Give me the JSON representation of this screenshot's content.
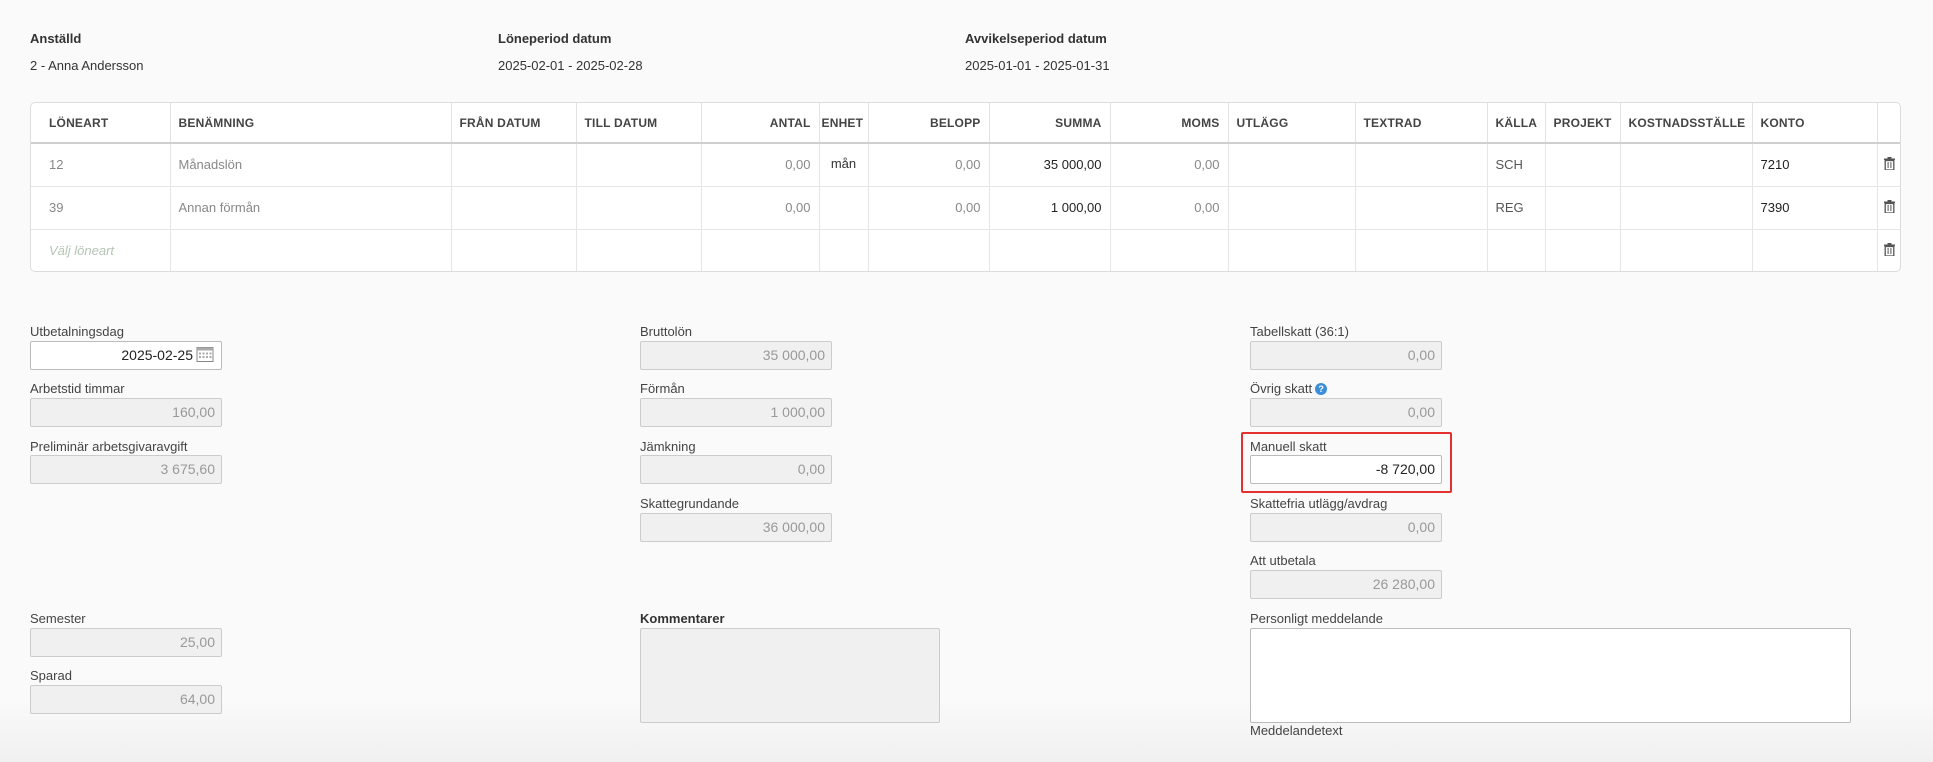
{
  "header": {
    "employee_label": "Anställd",
    "employee_value": "2 - Anna Andersson",
    "period_label": "Löneperiod datum",
    "period_value": "2025-02-01 - 2025-02-28",
    "deviation_label": "Avvikelseperiod datum",
    "deviation_value": "2025-01-01 - 2025-01-31"
  },
  "table": {
    "columns": [
      "LÖNEART",
      "BENÄMNING",
      "FRÅN DATUM",
      "TILL DATUM",
      "ANTAL",
      "ENHET",
      "BELOPP",
      "SUMMA",
      "MOMS",
      "UTLÄGG",
      "TEXTRAD",
      "KÄLLA",
      "PROJEKT",
      "KOSTNADSSTÄLLE",
      "KONTO"
    ],
    "rows": [
      {
        "loneart": "12",
        "benamning": "Månadslön",
        "fran": "",
        "till": "",
        "antal": "0,00",
        "enhet": "mån",
        "belopp": "0,00",
        "summa": "35 000,00",
        "moms": "0,00",
        "utlagg": "",
        "textrad": "",
        "kalla": "SCH",
        "projekt": "",
        "kostnadsstalle": "",
        "konto": "7210"
      },
      {
        "loneart": "39",
        "benamning": "Annan förmån",
        "fran": "",
        "till": "",
        "antal": "0,00",
        "enhet": "",
        "belopp": "0,00",
        "summa": "1 000,00",
        "moms": "0,00",
        "utlagg": "",
        "textrad": "",
        "kalla": "REG",
        "projekt": "",
        "kostnadsstalle": "",
        "konto": "7390"
      }
    ],
    "new_row_placeholder": "Välj löneart",
    "delete_icon": "trash-icon"
  },
  "form": {
    "payment_day_label": "Utbetalningsdag",
    "payment_day_value": "2025-02-25",
    "work_hours_label": "Arbetstid timmar",
    "work_hours_value": "160,00",
    "employer_fee_label": "Preliminär arbetsgivaravgift",
    "employer_fee_value": "3 675,60",
    "gross_label": "Bruttolön",
    "gross_value": "35 000,00",
    "benefit_label": "Förmån",
    "benefit_value": "1 000,00",
    "adjustment_label": "Jämkning",
    "adjustment_value": "0,00",
    "taxable_label": "Skattegrundande",
    "taxable_value": "36 000,00",
    "table_tax_label": "Tabellskatt (36:1)",
    "table_tax_value": "0,00",
    "other_tax_label": "Övrig skatt",
    "other_tax_value": "0,00",
    "manual_tax_label": "Manuell skatt",
    "manual_tax_value": "-8 720,00",
    "taxfree_label": "Skattefria utlägg/avdrag",
    "taxfree_value": "0,00",
    "to_pay_label": "Att utbetala",
    "to_pay_value": "26 280,00",
    "vacation_label": "Semester",
    "vacation_value": "25,00",
    "saved_label": "Sparad",
    "saved_value": "64,00",
    "comments_label": "Kommentarer",
    "personal_message_label": "Personligt meddelande",
    "message_text_label": "Meddelandetext"
  },
  "colors": {
    "highlight": "#e53030",
    "info": "#3b8edb"
  }
}
